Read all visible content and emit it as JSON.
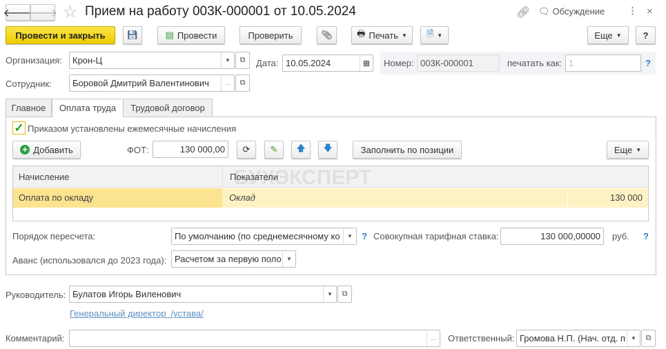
{
  "window": {
    "title": "Прием на работу 003К-000001 от 10.05.2024",
    "discussion": "Обсуждение"
  },
  "toolbar": {
    "post_close": "Провести и закрыть",
    "post": "Провести",
    "check": "Проверить",
    "print": "Печать",
    "more": "Еще",
    "help": "?"
  },
  "header": {
    "org_label": "Организация:",
    "org_value": "Крон-Ц",
    "date_label": "Дата:",
    "date_value": "10.05.2024",
    "number_label": "Номер:",
    "number_value": "003К-000001",
    "print_as_label": "печатать как:",
    "print_as_placeholder": "1",
    "employee_label": "Сотрудник:",
    "employee_value": "Боровой Дмитрий Валентинович",
    "help": "?"
  },
  "tabs": [
    {
      "label": "Главное"
    },
    {
      "label": "Оплата труда"
    },
    {
      "label": "Трудовой договор"
    }
  ],
  "pay": {
    "checkbox_label": "Приказом установлены ежемесячные начисления",
    "checked": true,
    "add": "Добавить",
    "fot_label": "ФОТ:",
    "fot_value": "130 000,00",
    "fill": "Заполнить по позиции",
    "more": "Еще",
    "columns": [
      "Начисление",
      "Показатели"
    ],
    "rows": [
      {
        "accrual": "Оплата по окладу",
        "indicator": "Оклад",
        "value": "130 000"
      }
    ],
    "watermark": "БУХЭКСПЕРТ",
    "recalc_label": "Порядок пересчета:",
    "recalc_value": "По умолчанию (по среднемесячному ко",
    "rate_label": "Совокупная тарифная ставка:",
    "rate_value": "130 000,00000",
    "rate_unit": "руб.",
    "advance_label": "Аванс (использовался до 2023 года):",
    "advance_value": "Расчетом за первую поло",
    "help": "?"
  },
  "footer": {
    "head_label": "Руководитель:",
    "head_value": "Булатов Игорь Виленович",
    "head_link": "Генеральный директор  /устава/",
    "comment_label": "Комментарий:",
    "comment_value": "",
    "responsible_label": "Ответственный:",
    "responsible_value": "Громова Н.П. (Нач. отд. п"
  }
}
